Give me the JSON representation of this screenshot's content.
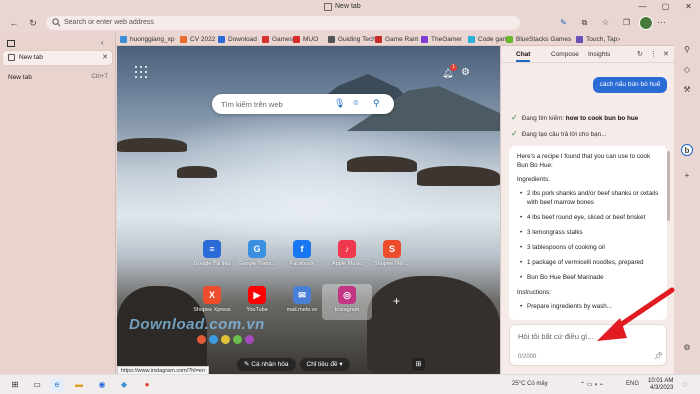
{
  "window": {
    "title": "New tab"
  },
  "address_bar": {
    "placeholder": "Search or enter web address"
  },
  "favorites": [
    {
      "label": "huonggiang_xp",
      "color": "#3a8fd6"
    },
    {
      "label": "CV 2022",
      "color": "#e86a2c"
    },
    {
      "label": "Download",
      "color": "#2b6bd6"
    },
    {
      "label": "Games",
      "color": "#d6322b"
    },
    {
      "label": "MUO",
      "color": "#d62b2b"
    },
    {
      "label": "Guiding Tech",
      "color": "#555555"
    },
    {
      "label": "Game Rant",
      "color": "#c92b2b"
    },
    {
      "label": "TheGamer",
      "color": "#7b3fd6"
    },
    {
      "label": "Code game",
      "color": "#2bb0d6"
    },
    {
      "label": "BlueStacks Games",
      "color": "#6ab82b"
    },
    {
      "label": "Touch, Tap",
      "color": "#6b4fb8"
    }
  ],
  "vertical_tabs": {
    "items": [
      {
        "label": "New tab",
        "close": "✕"
      },
      {
        "label": "New tab",
        "shortcut": "Ctrl+T"
      }
    ]
  },
  "ntp": {
    "search_placeholder": "Tìm kiếm trên web",
    "notification_count": "1",
    "tiles": [
      {
        "label": "Google Tài liệu",
        "color": "#2b6bd6",
        "glyph": "≡"
      },
      {
        "label": "Google Trans...",
        "color": "#3a8fe0",
        "glyph": "G"
      },
      {
        "label": "Facebook",
        "color": "#1877f2",
        "glyph": "f"
      },
      {
        "label": "Apple Music",
        "color": "#f0384e",
        "glyph": "♪"
      },
      {
        "label": "Shopee Việt ...",
        "color": "#ee4d2d",
        "glyph": "S"
      },
      {
        "label": "Shopee Xpress",
        "color": "#ee4d2d",
        "glyph": "X"
      },
      {
        "label": "YouTube",
        "color": "#ff0000",
        "glyph": "▶"
      },
      {
        "label": "mail.mets.vn",
        "color": "#4a7fd6",
        "glyph": "✉"
      },
      {
        "label": "Instagram",
        "color": "#c13584",
        "glyph": "◎"
      }
    ],
    "watermark": "Download.com.vn",
    "personalize_label": "Cá nhân hóa",
    "focus_label": "Chỉ tiêu đề",
    "status_url": "https://www.instagram.com/?hl=en"
  },
  "chat": {
    "tabs": [
      "Chat",
      "Compose",
      "Insights"
    ],
    "user_message": "cách nấu bún bò huế",
    "status_1_prefix": "Đang tìm kiếm: ",
    "status_1_query": "how to cook bun bo hue",
    "status_2": "Đang tạo câu trả lời cho bạn...",
    "answer_intro": "Here's a recipe I found that you can use to cook Bun Bo Hue:",
    "ingredients_label": "Ingredients:",
    "ingredients": [
      "2 lbs pork shanks and/or beef shanks or oxtails with beef marrow bones",
      "4 lbs beef round eye, sliced or beef brisket",
      "3 lemongrass stalks",
      "3 tablespoons of cooking oil",
      "1 package of vermicelli noodles, prepared",
      "Bun Bo Hue Beef Marinade"
    ],
    "instructions_label": "Instructions:",
    "instructions_partial": "Prepare ingredients by wash...",
    "input_placeholder": "Hỏi tôi bất cứ điều gì...",
    "counter": "0/2000"
  },
  "taskbar": {
    "weather": "25°C Có mây",
    "language": "ENG",
    "time": "10:01 AM",
    "date": "4/3/2023"
  }
}
